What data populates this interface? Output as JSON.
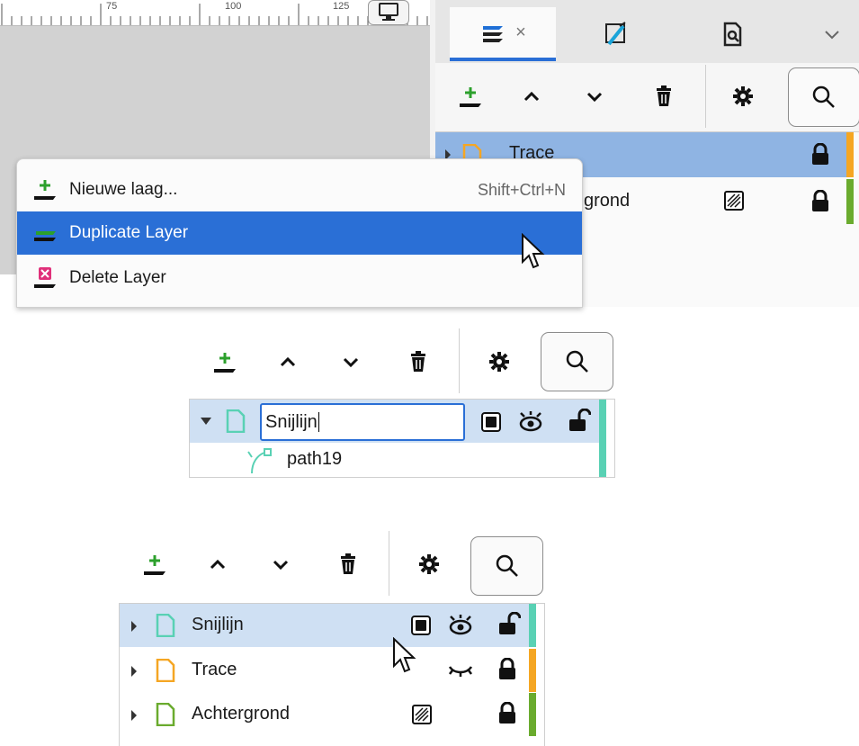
{
  "panel_top": {
    "ruler": {
      "numbers": [
        "75",
        "100",
        "125"
      ]
    },
    "tabs": [
      {
        "name": "layers-objects",
        "close_glyph": "×"
      },
      {
        "name": "fill-stroke"
      },
      {
        "name": "document-properties"
      }
    ],
    "toolbar_icons": [
      "add-layer-icon",
      "raise-layer-icon",
      "lower-layer-icon",
      "delete-layer-icon",
      "settings-gear-icon",
      "search-icon"
    ],
    "layers": [
      {
        "name": "Trace",
        "color": "#f5a623",
        "selected": true
      },
      {
        "name": "grond",
        "color": "#6aab2e",
        "selected": false
      }
    ],
    "context_menu": {
      "items": [
        {
          "label": "Nieuwe laag...",
          "accelerator": "Shift+Ctrl+N",
          "icon": "new-layer-icon"
        },
        {
          "label": "Duplicate Layer",
          "accelerator": "",
          "icon": "duplicate-layer-icon",
          "highlighted": true
        },
        {
          "label": "Delete Layer",
          "accelerator": "",
          "icon": "delete-layer-icon"
        }
      ]
    }
  },
  "panel_middle": {
    "rename_value": "Snijlijn",
    "child_object": "path19",
    "layer_color": "#59d1b4"
  },
  "panel_bottom": {
    "layers": [
      {
        "name": "Snijlijn",
        "color": "#59d1b4",
        "selected": true
      },
      {
        "name": "Trace",
        "color": "#f5a623",
        "selected": false
      },
      {
        "name": "Achtergrond",
        "color": "#6aab2e",
        "selected": false
      }
    ]
  },
  "colors": {
    "accent": "#2a6fd6",
    "selected_row": "#8fb4e3",
    "light_selected_row": "#cfe0f3"
  }
}
